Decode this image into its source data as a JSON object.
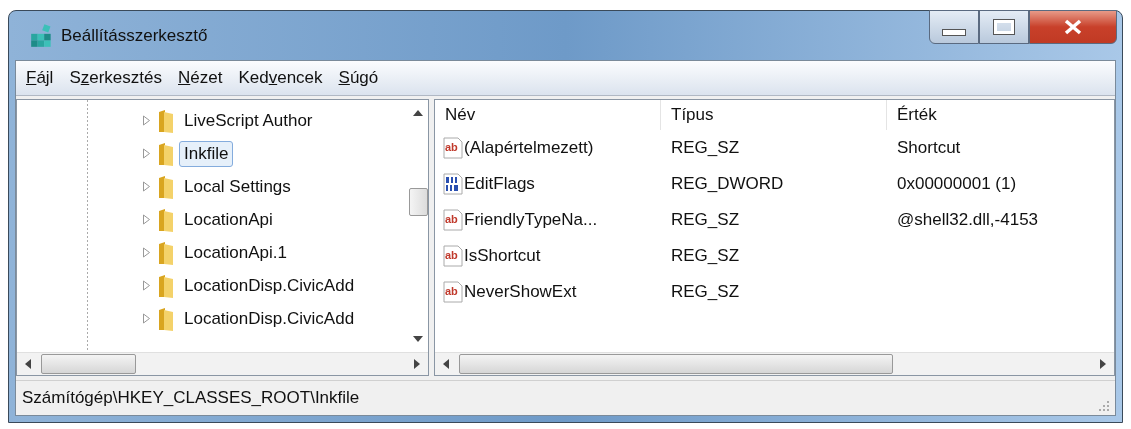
{
  "window": {
    "title": "Beállításszerkesztő"
  },
  "menu": [
    {
      "key": "F",
      "post": "ájl"
    },
    {
      "pre": "S",
      "key": "z",
      "post": "erkesztés"
    },
    {
      "key": "N",
      "post": "ézet"
    },
    {
      "pre": "Ked",
      "key": "v",
      "post": "encek"
    },
    {
      "key": "S",
      "post": "úgó"
    }
  ],
  "tree": {
    "items": [
      {
        "label": "LiveScript Author",
        "selected": false,
        "expanded": false
      },
      {
        "label": "Inkfile",
        "selected": true,
        "expanded": false
      },
      {
        "label": "Local Settings",
        "selected": false,
        "expanded": false
      },
      {
        "label": "LocationApi",
        "selected": false,
        "expanded": false
      },
      {
        "label": "LocationApi.1",
        "selected": false,
        "expanded": false
      },
      {
        "label": "LocationDisp.CivicAdd",
        "selected": false,
        "expanded": false
      },
      {
        "label": "LocationDisp.CivicAdd",
        "selected": false,
        "expanded": false
      }
    ]
  },
  "values": {
    "columns": [
      "Név",
      "Típus",
      "Érték"
    ],
    "rows": [
      {
        "kind": "string",
        "icon_text": "ab",
        "name": "(Alapértelmezett)",
        "type": "REG_SZ",
        "data": "Shortcut"
      },
      {
        "kind": "dword",
        "name": "EditFlags",
        "type": "REG_DWORD",
        "data": "0x00000001 (1)"
      },
      {
        "kind": "string",
        "icon_text": "ab",
        "name": "FriendlyTypeNa...",
        "type": "REG_SZ",
        "data": "@shell32.dll,-4153"
      },
      {
        "kind": "string",
        "icon_text": "ab",
        "name": "IsShortcut",
        "type": "REG_SZ"
      },
      {
        "kind": "string",
        "icon_text": "ab",
        "name": "NeverShowExt",
        "type": "REG_SZ"
      }
    ]
  },
  "status_bar": "Számítógép\\HKEY_CLASSES_ROOT\\Inkfile"
}
